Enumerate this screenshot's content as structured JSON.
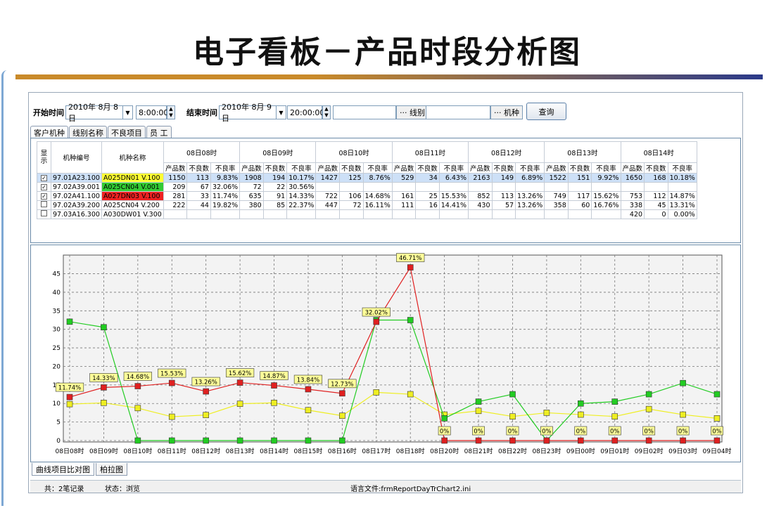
{
  "slide": {
    "title": "电子看板－产品时段分析图"
  },
  "toolbar": {
    "start_label": "开始时间",
    "start_date": "2010年 8月 8日",
    "start_time": "8:00:00",
    "end_label": "结束时间",
    "end_date": "2010年 8月 9日",
    "end_time": "20:00:00",
    "line_button": "··· 线别",
    "model_button": "··· 机种",
    "query_button": "查询"
  },
  "tabs": [
    "客户机种",
    "线别名称",
    "不良项目",
    "员 工"
  ],
  "grid": {
    "show_header": "显示",
    "code_header": "机种编号",
    "name_header": "机种名称",
    "periods": [
      "08日08时",
      "08日09时",
      "08日10时",
      "08日11时",
      "08日12时",
      "08日13时",
      "08日14时"
    ],
    "sub_headers": [
      "产品数",
      "不良数",
      "不良率"
    ],
    "rows": [
      {
        "checked": true,
        "code": "97.01A23.100",
        "name": "A025DN01 V.100",
        "color": "#ffff33",
        "sel": true,
        "cells": [
          [
            "1150",
            "113",
            "9.83%"
          ],
          [
            "1908",
            "194",
            "10.17%"
          ],
          [
            "1427",
            "125",
            "8.76%"
          ],
          [
            "529",
            "34",
            "6.43%"
          ],
          [
            "2163",
            "149",
            "6.89%"
          ],
          [
            "1522",
            "151",
            "9.92%"
          ],
          [
            "1650",
            "168",
            "10.18%"
          ]
        ]
      },
      {
        "checked": true,
        "code": "97.02A39.001",
        "name": "A025CN04 V.001",
        "color": "#33cc33",
        "sel": false,
        "cells": [
          [
            "209",
            "67",
            "32.06%"
          ],
          [
            "72",
            "22",
            "30.56%"
          ],
          [
            "",
            "",
            ""
          ],
          [
            "",
            "",
            ""
          ],
          [
            "",
            "",
            ""
          ],
          [
            "",
            "",
            ""
          ],
          [
            "",
            "",
            ""
          ]
        ]
      },
      {
        "checked": true,
        "code": "97.02A41.100",
        "name": "A027DN03 V.100",
        "color": "#ee2222",
        "sel": false,
        "cells": [
          [
            "281",
            "33",
            "11.74%"
          ],
          [
            "635",
            "91",
            "14.33%"
          ],
          [
            "722",
            "106",
            "14.68%"
          ],
          [
            "161",
            "25",
            "15.53%"
          ],
          [
            "852",
            "113",
            "13.26%"
          ],
          [
            "749",
            "117",
            "15.62%"
          ],
          [
            "753",
            "112",
            "14.87%"
          ]
        ]
      },
      {
        "checked": false,
        "code": "97.02A39.200",
        "name": "A025CN04 V.200",
        "color": "",
        "sel": false,
        "cells": [
          [
            "222",
            "44",
            "19.82%"
          ],
          [
            "380",
            "85",
            "22.37%"
          ],
          [
            "447",
            "72",
            "16.11%"
          ],
          [
            "111",
            "16",
            "14.41%"
          ],
          [
            "430",
            "57",
            "13.26%"
          ],
          [
            "358",
            "60",
            "16.76%"
          ],
          [
            "338",
            "45",
            "13.31%"
          ]
        ]
      },
      {
        "checked": false,
        "code": "97.03A16.300",
        "name": "A030DW01 V.300",
        "color": "",
        "sel": false,
        "cells": [
          [
            "",
            "",
            ""
          ],
          [
            "",
            "",
            ""
          ],
          [
            "",
            "",
            ""
          ],
          [
            "",
            "",
            ""
          ],
          [
            "",
            "",
            ""
          ],
          [
            "",
            "",
            ""
          ],
          [
            "420",
            "0",
            "0.00%"
          ]
        ]
      }
    ]
  },
  "chart_data": {
    "type": "line",
    "categories": [
      "08日08时",
      "08日09时",
      "08日10时",
      "08日11时",
      "08日12时",
      "08日13时",
      "08日14时",
      "08日15时",
      "08日16时",
      "08日17时",
      "08日18时",
      "08日20时",
      "08日21时",
      "08日22时",
      "08日23时",
      "09日00时",
      "09日01时",
      "09日02时",
      "09日03时",
      "09日04时"
    ],
    "ylim": [
      0,
      47
    ],
    "yticks": [
      0,
      5,
      10,
      15,
      20,
      25,
      30,
      35,
      40,
      45
    ],
    "grid": true,
    "series": [
      {
        "color": "#e02020",
        "values": [
          11.74,
          14.33,
          14.68,
          15.53,
          13.26,
          15.62,
          14.87,
          13.84,
          12.73,
          32.02,
          46.71,
          0,
          0,
          0,
          0,
          0,
          0,
          0,
          0,
          0
        ],
        "labels": [
          "11.74%",
          "14.33%",
          "14.68%",
          "15.53%",
          "13.26%",
          "15.62%",
          "14.87%",
          "13.84%",
          "12.73%",
          "32.02%",
          "46.71%",
          "0%",
          "0%",
          "0%",
          "0%",
          "0%",
          "0%",
          "0%",
          "0%",
          "0%"
        ]
      },
      {
        "color": "#22cc22",
        "values": [
          32.06,
          30.56,
          0,
          0,
          0,
          0,
          0,
          0,
          0,
          32.5,
          32.5,
          6,
          10.5,
          12.5,
          0,
          10,
          10.5,
          12.5,
          15.5,
          12.5
        ]
      },
      {
        "color": "#eeee22",
        "values": [
          9.83,
          10.17,
          8.76,
          6.43,
          6.89,
          9.92,
          10.18,
          8.2,
          6.7,
          13,
          12.5,
          7,
          8,
          6.5,
          7.5,
          7,
          6.5,
          8.5,
          7,
          6
        ]
      }
    ]
  },
  "bottom_tabs": [
    "曲线项目比对图",
    "柏拉图"
  ],
  "status": {
    "records": "共：2笔记录",
    "state": "状态：浏览",
    "file": "语言文件:frmReportDayTrChart2.ini"
  }
}
